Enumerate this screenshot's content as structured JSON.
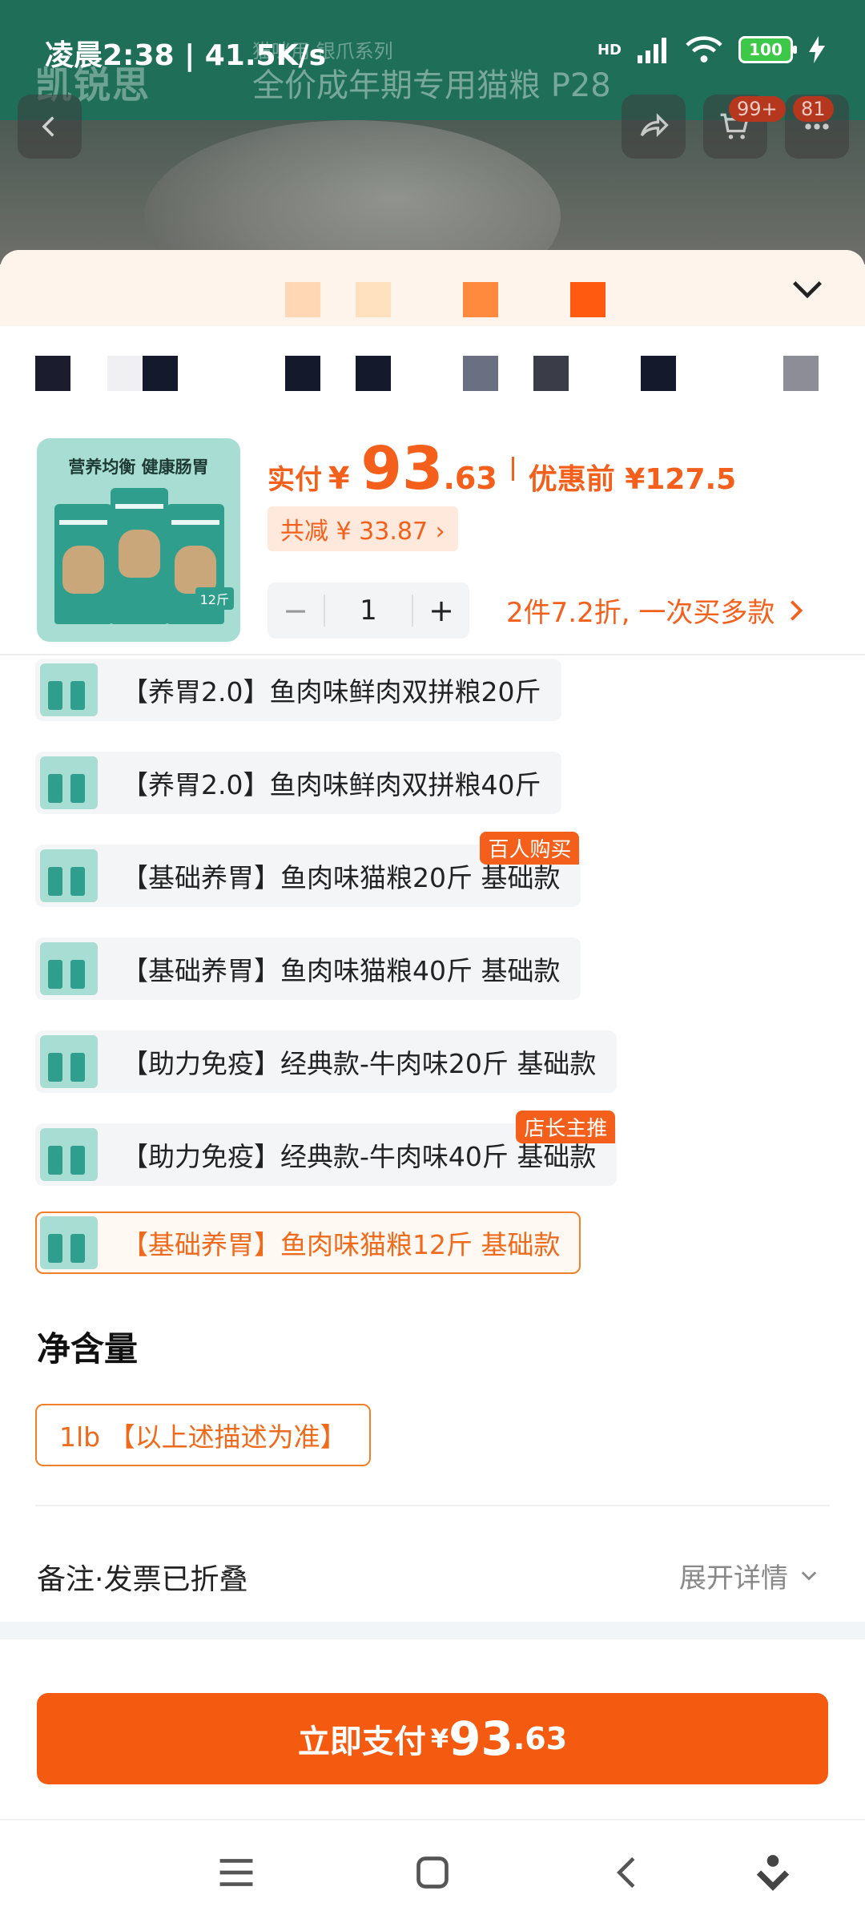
{
  "status_bar": {
    "time": "凌晨2:38 | 41.5K/s",
    "battery": "100",
    "network": "HD"
  },
  "background_page": {
    "brand": "凯锐思",
    "subtitle": "猫咪用 银爪系列",
    "title": "全价成年期专用猫粮 P28",
    "cart_badge": "99+",
    "message_badge": "81"
  },
  "sku": {
    "thumb_heading": "营养均衡  健康肠胃",
    "thumb_tag": "12斤",
    "pay_label": "实付",
    "currency": "¥",
    "price_int": "93",
    "price_dec": ".63",
    "original_label": "优惠前 ¥127.5",
    "discount_label": "共减 ¥ 33.87 ›",
    "quantity": "1",
    "minus": "−",
    "plus": "+",
    "promo_label": "2件7.2折, 一次买多款"
  },
  "options": [
    {
      "label": "【养胃2.0】鱼肉味鲜肉双拼粮20斤",
      "tag": ""
    },
    {
      "label": "【养胃2.0】鱼肉味鲜肉双拼粮40斤",
      "tag": ""
    },
    {
      "label": "【基础养胃】鱼肉味猫粮20斤 基础款",
      "tag": "百人购买"
    },
    {
      "label": "【基础养胃】鱼肉味猫粮40斤 基础款",
      "tag": ""
    },
    {
      "label": "【助力免疫】经典款-牛肉味20斤 基础款",
      "tag": ""
    },
    {
      "label": "【助力免疫】经典款-牛肉味40斤 基础款",
      "tag": "店长主推"
    },
    {
      "label": "【基础养胃】鱼肉味猫粮12斤 基础款",
      "tag": "",
      "selected": true
    }
  ],
  "net_content": {
    "title": "净含量",
    "option": "1lb 【以上述描述为准】"
  },
  "remark": {
    "label": "备注·发票已折叠",
    "expand": "展开详情"
  },
  "pay_button": {
    "label": "立即支付",
    "currency": "¥",
    "price_int": "93",
    "price_dec": ".63"
  },
  "colors": {
    "accent": "#f4601b",
    "selected_border": "#f08029",
    "option_bg": "#f3f5f7",
    "header_green": "#1f6f58"
  }
}
